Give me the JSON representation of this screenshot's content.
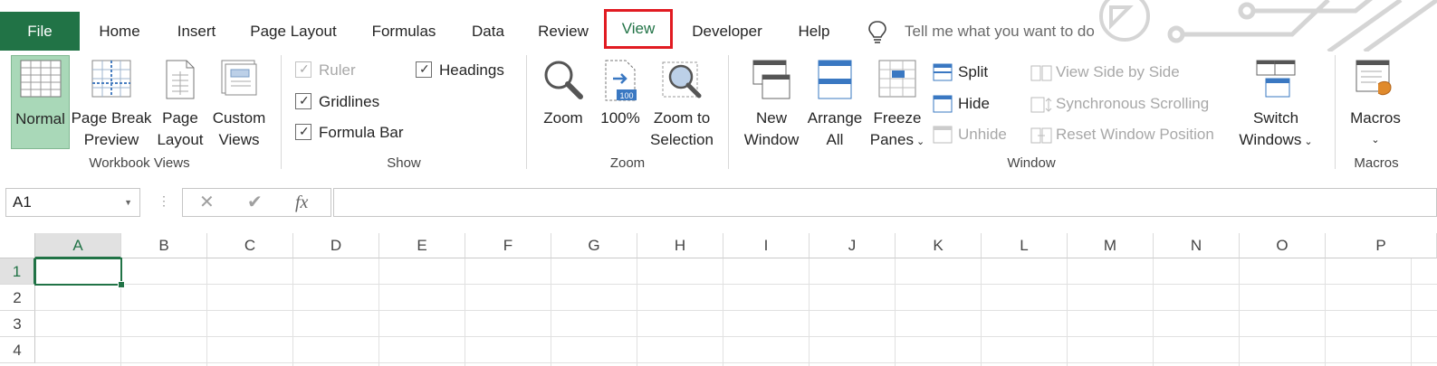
{
  "tabs": [
    {
      "key": "file",
      "label": "File"
    },
    {
      "key": "home",
      "label": "Home"
    },
    {
      "key": "insert",
      "label": "Insert"
    },
    {
      "key": "page_layout",
      "label": "Page Layout"
    },
    {
      "key": "formulas",
      "label": "Formulas"
    },
    {
      "key": "data",
      "label": "Data"
    },
    {
      "key": "review",
      "label": "Review"
    },
    {
      "key": "view",
      "label": "View"
    },
    {
      "key": "developer",
      "label": "Developer"
    },
    {
      "key": "help",
      "label": "Help"
    }
  ],
  "tell_me": {
    "placeholder": "Tell me what you want to do"
  },
  "ribbon": {
    "workbook_views": {
      "label": "Workbook Views",
      "normal": "Normal",
      "page_break_1": "Page Break",
      "page_break_2": "Preview",
      "page_layout_1": "Page",
      "page_layout_2": "Layout",
      "custom_1": "Custom",
      "custom_2": "Views"
    },
    "show": {
      "label": "Show",
      "ruler": "Ruler",
      "ruler_checked": true,
      "ruler_disabled": true,
      "gridlines": "Gridlines",
      "gridlines_checked": true,
      "formula_bar": "Formula Bar",
      "formula_bar_checked": true,
      "headings": "Headings",
      "headings_checked": true
    },
    "zoom": {
      "label": "Zoom",
      "zoom": "Zoom",
      "hundred": "100%",
      "hundred_badge": "100",
      "zoom_sel_1": "Zoom to",
      "zoom_sel_2": "Selection"
    },
    "window": {
      "label": "Window",
      "new_1": "New",
      "new_2": "Window",
      "arrange_1": "Arrange",
      "arrange_2": "All",
      "freeze_1": "Freeze",
      "freeze_2": "Panes",
      "split": "Split",
      "hide": "Hide",
      "unhide": "Unhide",
      "side_by_side": "View Side by Side",
      "sync_scroll": "Synchronous Scrolling",
      "reset_pos": "Reset Window Position",
      "switch_1": "Switch",
      "switch_2": "Windows"
    },
    "macros": {
      "label": "Macros",
      "macros": "Macros"
    }
  },
  "formula_bar": {
    "name_box": "A1",
    "fx": "fx",
    "value": ""
  },
  "sheet": {
    "columns": [
      "A",
      "B",
      "C",
      "D",
      "E",
      "F",
      "G",
      "H",
      "I",
      "J",
      "K",
      "L",
      "M",
      "N",
      "O",
      "P"
    ],
    "rows": [
      "1",
      "2",
      "3",
      "4"
    ],
    "active_cell": "A1"
  },
  "colors": {
    "accent": "#217346",
    "highlight": "#e11b22",
    "selected_view": "#a9d8b8"
  }
}
